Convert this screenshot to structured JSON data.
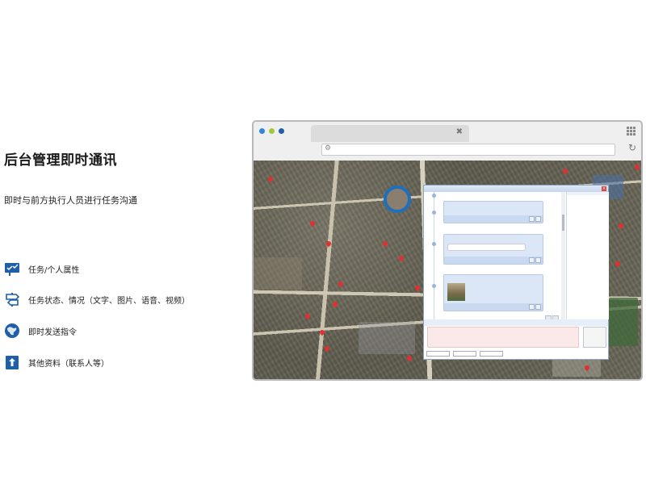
{
  "slide": {
    "title": "后台管理即时通讯",
    "subtitle": "即时与前方执行人员进行任务沟通",
    "features": [
      {
        "icon": "task-board-icon",
        "label": "任务/个人属性"
      },
      {
        "icon": "signpost-icon",
        "label": "任务状态、情况（文字、图片、语音、视频）"
      },
      {
        "icon": "globe-icon",
        "label": "即时发送指令"
      },
      {
        "icon": "upload-icon",
        "label": "其他资料（联系人等）"
      }
    ]
  },
  "browser": {
    "dot_colors": [
      "#2e86de",
      "#a4c639",
      "#1f5fa8"
    ]
  }
}
